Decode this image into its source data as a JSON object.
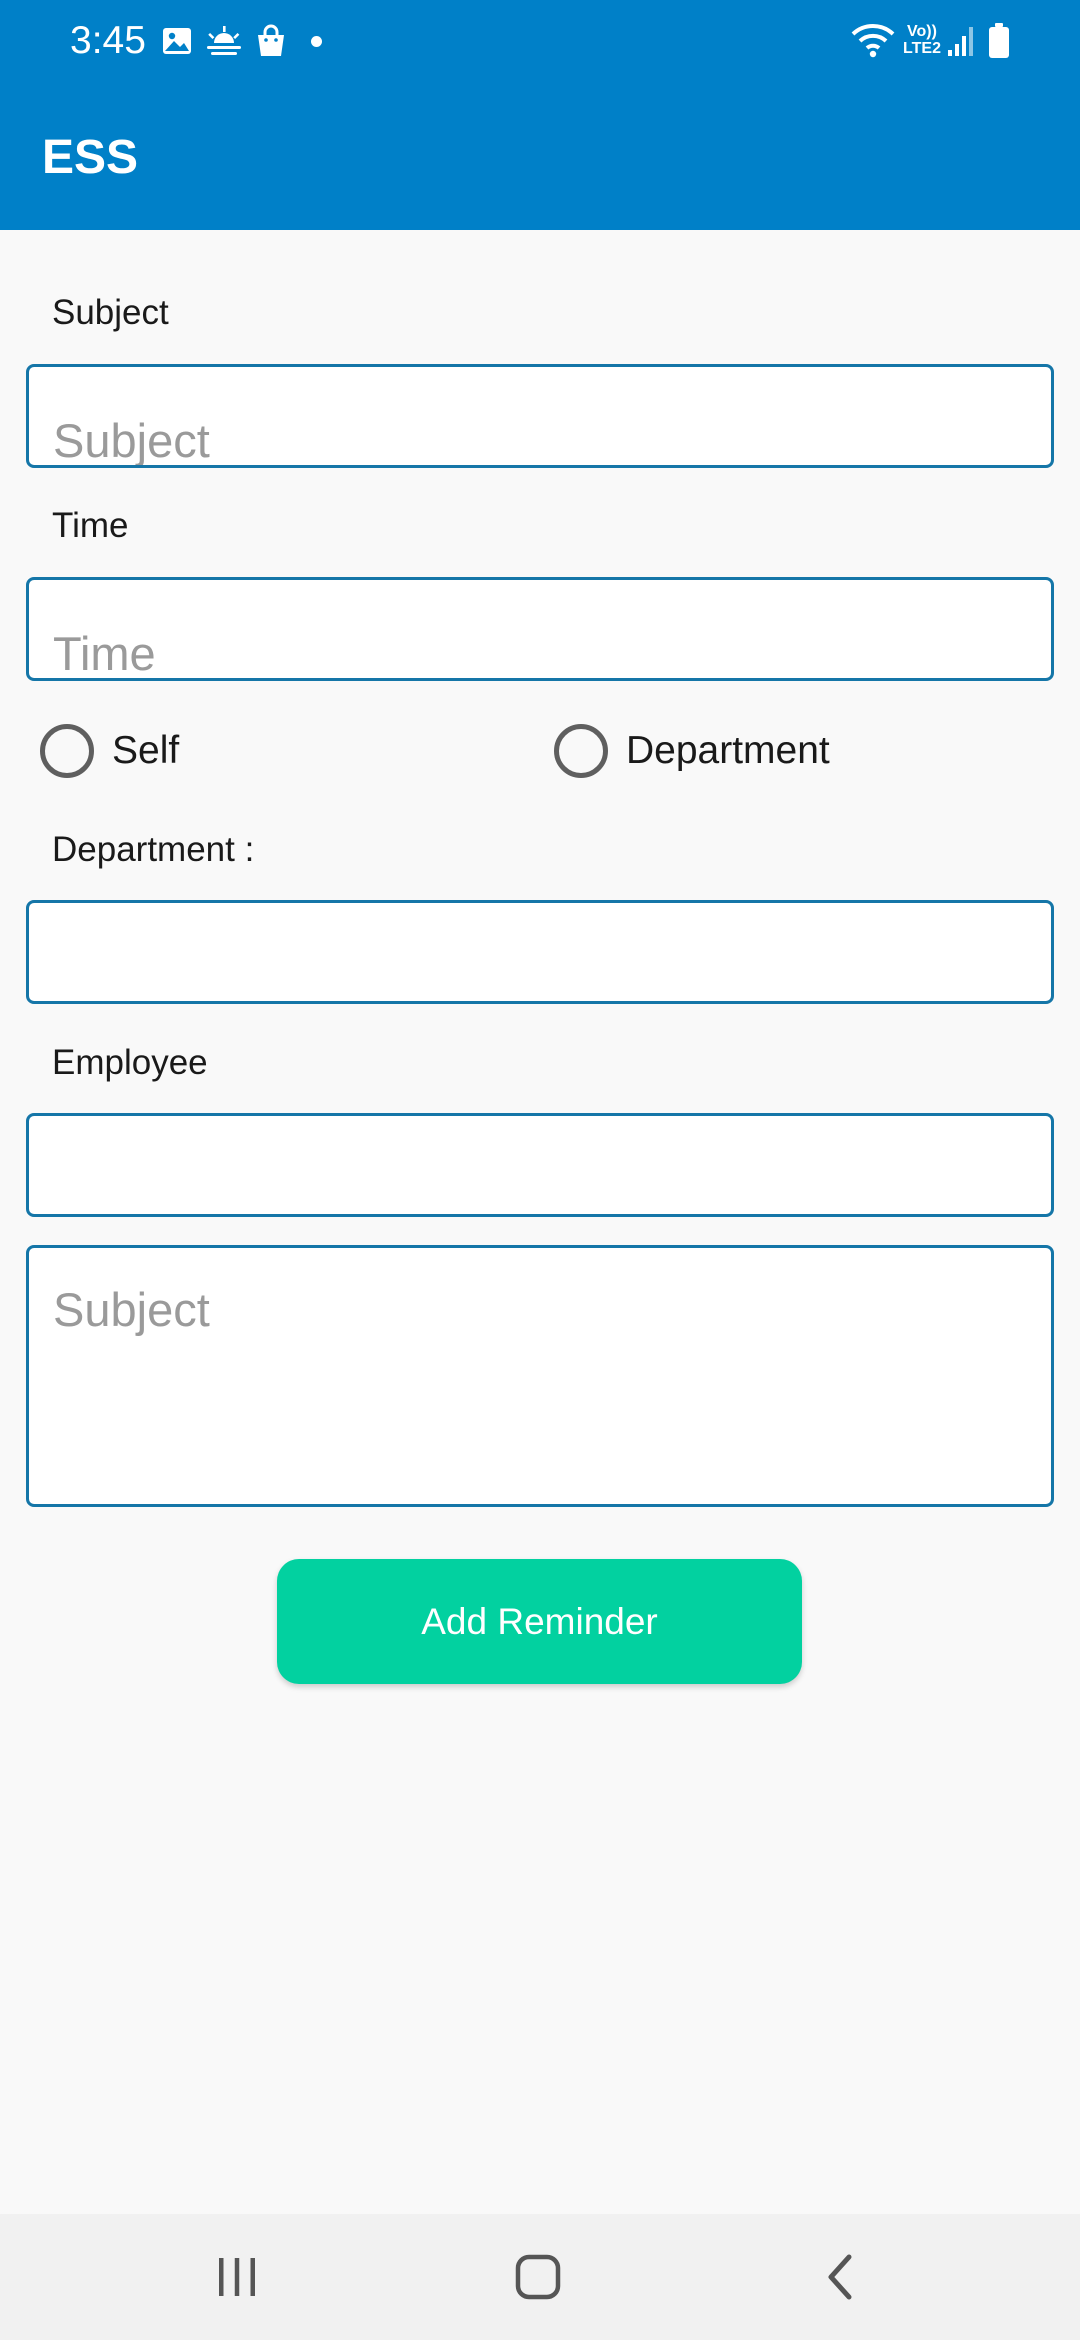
{
  "status_bar": {
    "time": "3:45",
    "volte_line1": "Vo))",
    "volte_line2": "LTE2",
    "icons": [
      "image-icon",
      "weather-icon",
      "shopping-bag-icon",
      "notification-dot",
      "wifi-icon",
      "volte-icon",
      "signal-icon",
      "battery-icon"
    ]
  },
  "app_bar": {
    "title": "ESS"
  },
  "form": {
    "subject_label": "Subject",
    "subject_placeholder": "Subject",
    "time_label": "Time",
    "time_placeholder": "Time",
    "radio_self": "Self",
    "radio_department": "Department",
    "department_label": "Department :",
    "department_value": "",
    "employee_label": "Employee",
    "employee_value": "",
    "message_placeholder": "Subject",
    "submit_label": "Add Reminder"
  },
  "navigation_bar": {
    "icons": [
      "recent-apps-icon",
      "home-icon",
      "back-icon"
    ]
  },
  "colors": {
    "app_bar": "#0080c8",
    "field_border": "#1576a8",
    "button": "#02d1a0",
    "background": "#f9f9f9"
  }
}
